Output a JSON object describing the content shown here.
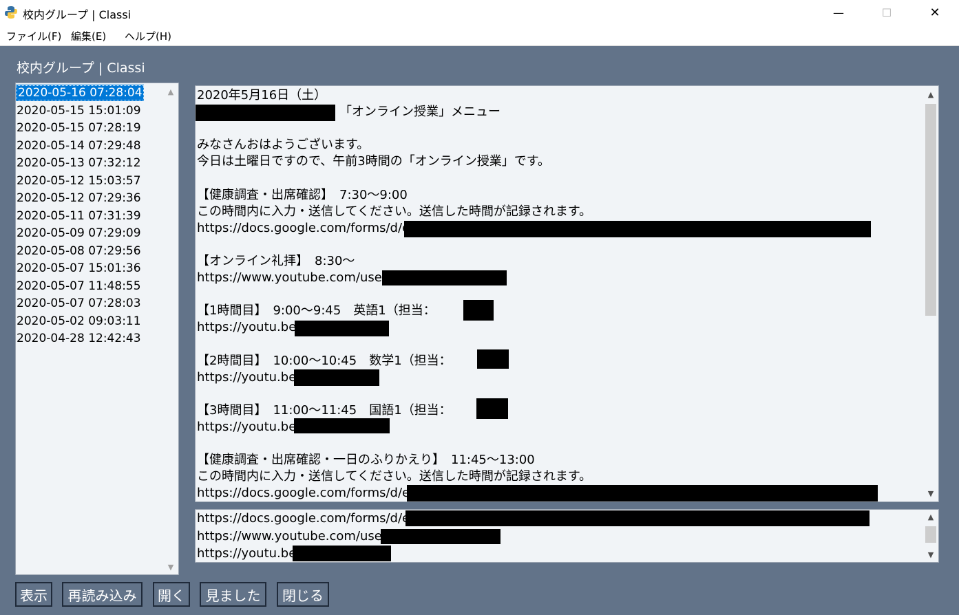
{
  "window": {
    "title": "校内グループ | Classi",
    "controls": {
      "minimize": "—",
      "maximize": "☐",
      "close": "✕"
    }
  },
  "menu": [
    "ファイル(F)",
    "編集(E)",
    "ヘルプ(H)"
  ],
  "heading": "校内グループ | Classi",
  "dates": [
    "2020-05-16 07:28:04",
    "2020-05-15 15:01:09",
    "2020-05-15 07:28:19",
    "2020-05-14 07:29:48",
    "2020-05-13 07:32:12",
    "2020-05-12 15:03:57",
    "2020-05-12 07:29:36",
    "2020-05-11 07:31:39",
    "2020-05-09 07:29:09",
    "2020-05-08 07:29:56",
    "2020-05-07 15:01:36",
    "2020-05-07 11:48:55",
    "2020-05-07 07:28:03",
    "2020-05-02 09:03:11",
    "2020-04-28 12:42:43"
  ],
  "selected_index": 0,
  "message_lines": [
    "2020年5月16日（土）",
    "　　　　　　　　　　　　「オンライン授業」メニュー",
    "",
    "みなさんおはようございます。",
    "今日は土曜日ですので、午前3時間の「オンライン授業」です。",
    "",
    "【健康調査・出席確認】　7:30～9:00",
    "この時間内に入力・送信してください。送信した時間が記録されます。",
    "https://docs.google.com/forms/d/e/",
    "",
    "【オンライン礼拝】　8:30～",
    "https://www.youtube.com/user/",
    "",
    "【1時間目】　9:00～9:45　英語1（担当：　　　）",
    "https://youtu.be/",
    "",
    "【2時間目】　10:00～10:45　数学1（担当：　　　）",
    "https://youtu.be/",
    "",
    "【3時間目】　11:00～11:45　国語1（担当：　　　）",
    "https://youtu.be/",
    "",
    "【健康調査・出席確認・一日のふりかえり】　11:45～13:00",
    "この時間内に入力・送信してください。送信した時間が記録されます。",
    "https://docs.google.com/forms/d/e/"
  ],
  "links": [
    "https://docs.google.com/forms/d/e/",
    "https://www.youtube.com/user/",
    "https://youtu.be/"
  ],
  "buttons": {
    "show": "表示",
    "reload": "再読み込み",
    "open": "開く",
    "seen": "見ました",
    "close": "閉じる"
  },
  "scroll_arrows": {
    "up": "▲",
    "down": "▼"
  }
}
